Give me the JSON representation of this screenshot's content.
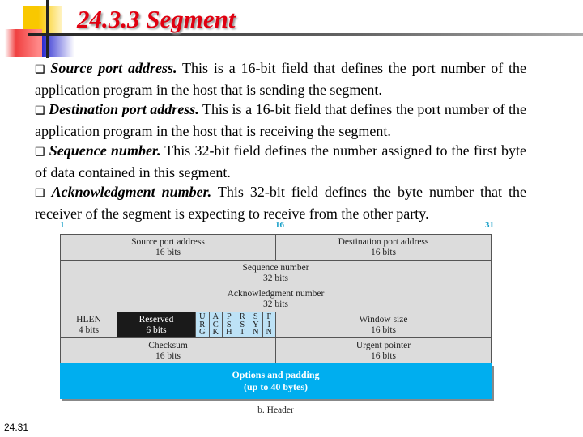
{
  "title": "24.3.3  Segment",
  "bullets": [
    {
      "term": "Source port address.",
      "text": " This is a 16-bit field that defines the port number of the application program in the host that is sending the segment."
    },
    {
      "term": "Destination port address.",
      "text": " This is a 16-bit field that defines the port number of the application program in the host that is receiving the segment."
    },
    {
      "term": "Sequence number.",
      "text": " This 32-bit field defines the number assigned to the first byte of data contained in this segment."
    },
    {
      "term": "Acknowledgment number.",
      "text": " This 32-bit field defines the byte number that the receiver of the segment is expecting to receive from the other party."
    }
  ],
  "bullet_icon": "checkbox-square-icon",
  "diagram": {
    "bits": {
      "start": "1",
      "mid": "16",
      "end": "31"
    },
    "source_port": {
      "name": "Source port address",
      "size": "16 bits"
    },
    "dest_port": {
      "name": "Destination port address",
      "size": "16 bits"
    },
    "seq": {
      "name": "Sequence number",
      "size": "32 bits"
    },
    "ack": {
      "name": "Acknowledgment number",
      "size": "32 bits"
    },
    "hlen": {
      "name": "HLEN",
      "size": "4 bits"
    },
    "reserved": {
      "name": "Reserved",
      "size": "6 bits"
    },
    "flags": [
      "URG",
      "ACK",
      "PSH",
      "RST",
      "SYN",
      "FIN"
    ],
    "window": {
      "name": "Window size",
      "size": "16 bits"
    },
    "checksum": {
      "name": "Checksum",
      "size": "16 bits"
    },
    "urgent": {
      "name": "Urgent pointer",
      "size": "16 bits"
    },
    "options": {
      "name": "Options and padding",
      "size": "(up to 40 bytes)"
    },
    "caption": "b. Header",
    "colors": {
      "fields": "#dcdcdc",
      "flags": "#bde2f6",
      "options": "#00aeef",
      "reserved": "#1a1a1a",
      "bit_labels": "#1aa0c8"
    }
  },
  "slide_number": "24.31"
}
